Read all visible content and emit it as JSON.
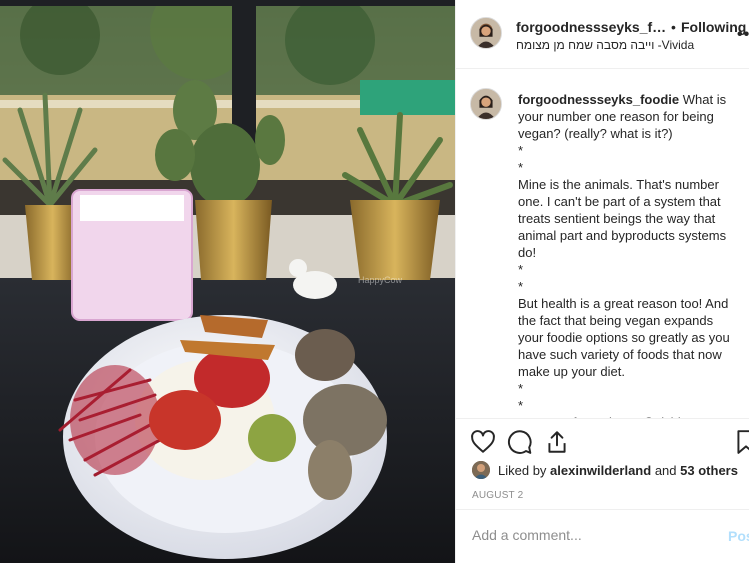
{
  "post": {
    "photo_watermark": "HappyCow",
    "header": {
      "username": "forgoodnessseyks_foodie",
      "separator": "•",
      "follow_label": "Following",
      "location": "וייבה מסבה שמח מן מצומח -Vivida",
      "more_icon": "more-horizontal-icon"
    },
    "caption": {
      "username": "forgoodnessseyks_foodie",
      "text": "What is your number one reason for being vegan? (really? what is it?)\n*\n*\nMine is the animals. That's number one. I can't be part of a system that treats sentient beings the way that animal part and byproducts systems do!\n*\n*\nBut health is a great reason too! And the fact that being vegan expands your foodie options so greatly as you have such variety of foods that now make up your diet.\n*\n*\nIt was so fun to be at @vivida.vegan"
    },
    "actions": {
      "like_icon": "heart-icon",
      "comment_icon": "comment-bubble-icon",
      "share_icon": "share-icon",
      "save_icon": "bookmark-icon"
    },
    "likes": {
      "prefix": "Liked by",
      "user": "alexinwilderland",
      "conjunction": "and",
      "others": "53 others"
    },
    "date": "AUGUST 2",
    "comment_box": {
      "placeholder": "Add a comment...",
      "post_label": "Post"
    }
  },
  "colors": {
    "text": "#262626",
    "secondary": "#8e8e8e",
    "divider": "#efefef",
    "post_disabled": "#b2dffc"
  }
}
